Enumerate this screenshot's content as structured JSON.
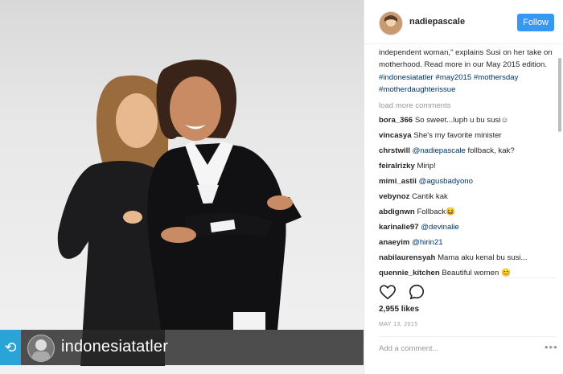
{
  "photo": {
    "repost_badge_icon": "repost-icon",
    "repost_username": "indonesiatatler"
  },
  "post": {
    "username": "nadiepascale",
    "follow_label": "Follow",
    "caption_text": "independent woman,\" explains Susi on her take on motherhood. Read more in our May 2015 edition.",
    "hashtags": [
      "#indonesiatatler",
      "#may2015",
      "#mothersday",
      "#motherdaughterissue"
    ],
    "load_more": "load more comments",
    "likes": "2,955 likes",
    "date": "MAY 13, 2015",
    "add_comment_placeholder": "Add a comment...",
    "more_label": "•••"
  },
  "comments": [
    {
      "user": "bora_366",
      "text": "So sweet...luph u bu susi☺",
      "mention": ""
    },
    {
      "user": "vincasya",
      "text": "She's my favorite minister",
      "mention": ""
    },
    {
      "user": "chrstwill",
      "text": " follback, kak?",
      "mention": "@nadiepascale"
    },
    {
      "user": "feiralrizky",
      "text": "Mirip!",
      "mention": ""
    },
    {
      "user": "mimi_astii",
      "text": "",
      "mention": "@agusbadyono"
    },
    {
      "user": "vebynoz",
      "text": "Cantik kak",
      "mention": ""
    },
    {
      "user": "abdignwn",
      "text": "Follback😆",
      "mention": ""
    },
    {
      "user": "karinalie97",
      "text": "",
      "mention": "@devinalie"
    },
    {
      "user": "anaeyim",
      "text": "",
      "mention": "@hirin21"
    },
    {
      "user": "nabilaurensyah",
      "text": "Mama aku kenal bu susi...",
      "mention": ""
    },
    {
      "user": "quennie_kitchen",
      "text": "Beautiful women 😊",
      "mention": ""
    }
  ],
  "colors": {
    "follow_bg": "#3897f0",
    "link": "#003569",
    "repost_badge": "#2aa3d6"
  }
}
